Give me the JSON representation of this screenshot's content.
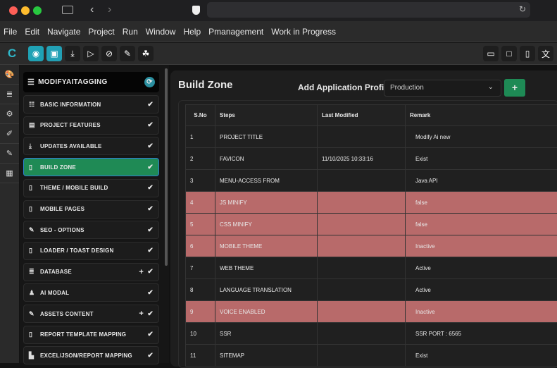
{
  "window": {
    "traffic_colors": [
      "#fe5f57",
      "#febc2e",
      "#28c840"
    ]
  },
  "menu": [
    "File",
    "Edit",
    "Navigate",
    "Project",
    "Run",
    "Window",
    "Help",
    "Pmanagement",
    "Work in Progress"
  ],
  "toolbar": {
    "left_icons": [
      "app-logo-icon",
      "plugin-icon",
      "save-icon",
      "download-icon",
      "run-icon",
      "stop-icon",
      "edit-icon",
      "cubes-icon"
    ],
    "right_icons": [
      "laptop-icon",
      "tablet-icon",
      "mobile-icon",
      "translate-icon"
    ]
  },
  "rail_icons": [
    "palette-icon",
    "database-icon",
    "settings-file-icon",
    "brush-icon",
    "edit-icon",
    "calculator-icon"
  ],
  "sidebar": {
    "title": "MODIFYAITAGGING",
    "items": [
      {
        "label": "BASIC INFORMATION",
        "icon": "☷",
        "plus": false
      },
      {
        "label": "PROJECT FEATURES",
        "icon": "▤",
        "plus": false
      },
      {
        "label": "UPDATES AVAILABLE",
        "icon": "⤓",
        "plus": false
      },
      {
        "label": "BUILD ZONE",
        "icon": "▯",
        "plus": false,
        "active": true
      },
      {
        "label": "THEME / MOBILE BUILD",
        "icon": "▯",
        "plus": false
      },
      {
        "label": "MOBILE PAGES",
        "icon": "▯",
        "plus": false
      },
      {
        "label": "SEO - OPTIONS",
        "icon": "✎",
        "plus": false
      },
      {
        "label": "LOADER / TOAST DESIGN",
        "icon": "▯",
        "plus": false
      },
      {
        "label": "DATABASE",
        "icon": "≣",
        "plus": true
      },
      {
        "label": "AI MODAL",
        "icon": "♟",
        "plus": false
      },
      {
        "label": "ASSETS CONTENT",
        "icon": "✎",
        "plus": true
      },
      {
        "label": "REPORT TEMPLATE MAPPING",
        "icon": "▯",
        "plus": false
      },
      {
        "label": "EXCEL/JSON/REPORT MAPPING",
        "icon": "▙",
        "plus": false
      }
    ]
  },
  "main": {
    "title": "Build Zone",
    "profile_label": "Add Application Profile",
    "profile_value": "Production",
    "add_label": "+",
    "columns": [
      "S.No",
      "Steps",
      "Last Modified",
      "Remark"
    ],
    "rows": [
      [
        "1",
        "PROJECT TITLE",
        "",
        "Modify Ai new",
        false
      ],
      [
        "2",
        "FAVICON",
        "11/10/2025 10:33:16",
        "Exist",
        false
      ],
      [
        "3",
        "MENU-ACCESS FROM",
        "",
        "Java API",
        false
      ],
      [
        "4",
        "JS MINIFY",
        "",
        "false",
        true
      ],
      [
        "5",
        "CSS MINIFY",
        "",
        "false",
        true
      ],
      [
        "6",
        "MOBILE THEME",
        "",
        "Inactive",
        true
      ],
      [
        "7",
        "WEB THEME",
        "",
        "Active",
        false
      ],
      [
        "8",
        "LANGUAGE TRANSLATION",
        "",
        "Active",
        false
      ],
      [
        "9",
        "VOICE ENABLED",
        "",
        "Inactive",
        true
      ],
      [
        "10",
        "SSR",
        "",
        "SSR PORT : 6565",
        false
      ],
      [
        "11",
        "SITEMAP",
        "",
        "Exist",
        false
      ]
    ]
  }
}
